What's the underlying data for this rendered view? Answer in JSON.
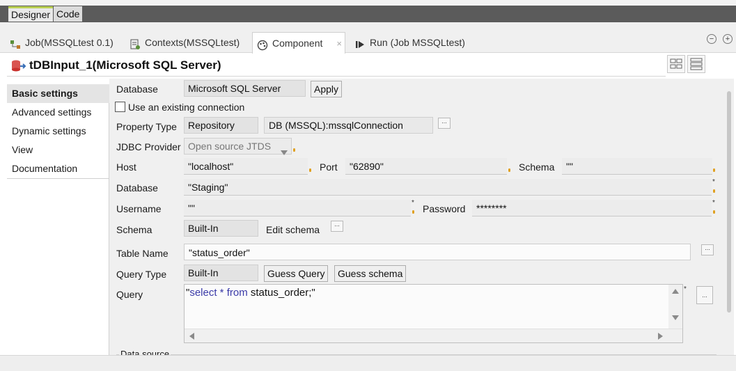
{
  "editor_tabs": [
    {
      "label": "Designer"
    },
    {
      "label": "Code"
    }
  ],
  "view_tabs": [
    {
      "label": "Job(MSSQLtest 0.1)",
      "icon": "job-icon"
    },
    {
      "label": "Contexts(MSSQLtest)",
      "icon": "contexts-icon"
    },
    {
      "label": "Component",
      "icon": "palette-icon",
      "close": "×"
    },
    {
      "label": "Run (Job MSSQLtest)",
      "icon": "run-icon"
    }
  ],
  "window_buttons": {
    "minimize": "−",
    "maximize": "+"
  },
  "component_title": "tDBInput_1(Microsoft SQL Server)",
  "left_menu": [
    {
      "label": "Basic settings"
    },
    {
      "label": "Advanced settings"
    },
    {
      "label": "Dynamic settings"
    },
    {
      "label": "View"
    },
    {
      "label": "Documentation"
    }
  ],
  "form": {
    "database_type_label": "Database",
    "database_type_value": "Microsoft SQL Server",
    "apply_button": "Apply",
    "use_existing_connection_label": "Use an existing connection",
    "use_existing_connection_checked": false,
    "property_type_label": "Property Type",
    "property_type_value": "Repository",
    "repository_value": "DB (MSSQL):mssqlConnection",
    "jdbc_provider_label": "JDBC Provider",
    "jdbc_provider_value": "Open source JTDS",
    "host_label": "Host",
    "host_value": "\"localhost\"",
    "port_label": "Port",
    "port_value": "\"62890\"",
    "schema_db_label": "Schema",
    "schema_db_value": "\"\"",
    "database_label": "Database",
    "database_value": "\"Staging\"",
    "username_label": "Username",
    "username_value": "\"\"",
    "password_label": "Password",
    "password_value": "********",
    "schema_label": "Schema",
    "schema_value": "Built-In",
    "edit_schema_label": "Edit schema",
    "table_name_label": "Table Name",
    "table_name_value": "\"status_order\"",
    "query_type_label": "Query Type",
    "query_type_value": "Built-In",
    "guess_query_button": "Guess Query",
    "guess_schema_button": "Guess schema",
    "query_label": "Query",
    "query_parts": {
      "q1": "\"",
      "kw_select": "select",
      "star": " * ",
      "kw_from": "from",
      "rest": " status_order;\""
    },
    "data_source_label": "Data source",
    "ellipsis": "...",
    "required_marker": "*"
  },
  "colors": {
    "active_tab_accent": "#b9cf52",
    "keyword": "#3a3aa8",
    "warning_marker": "#e0a020"
  }
}
